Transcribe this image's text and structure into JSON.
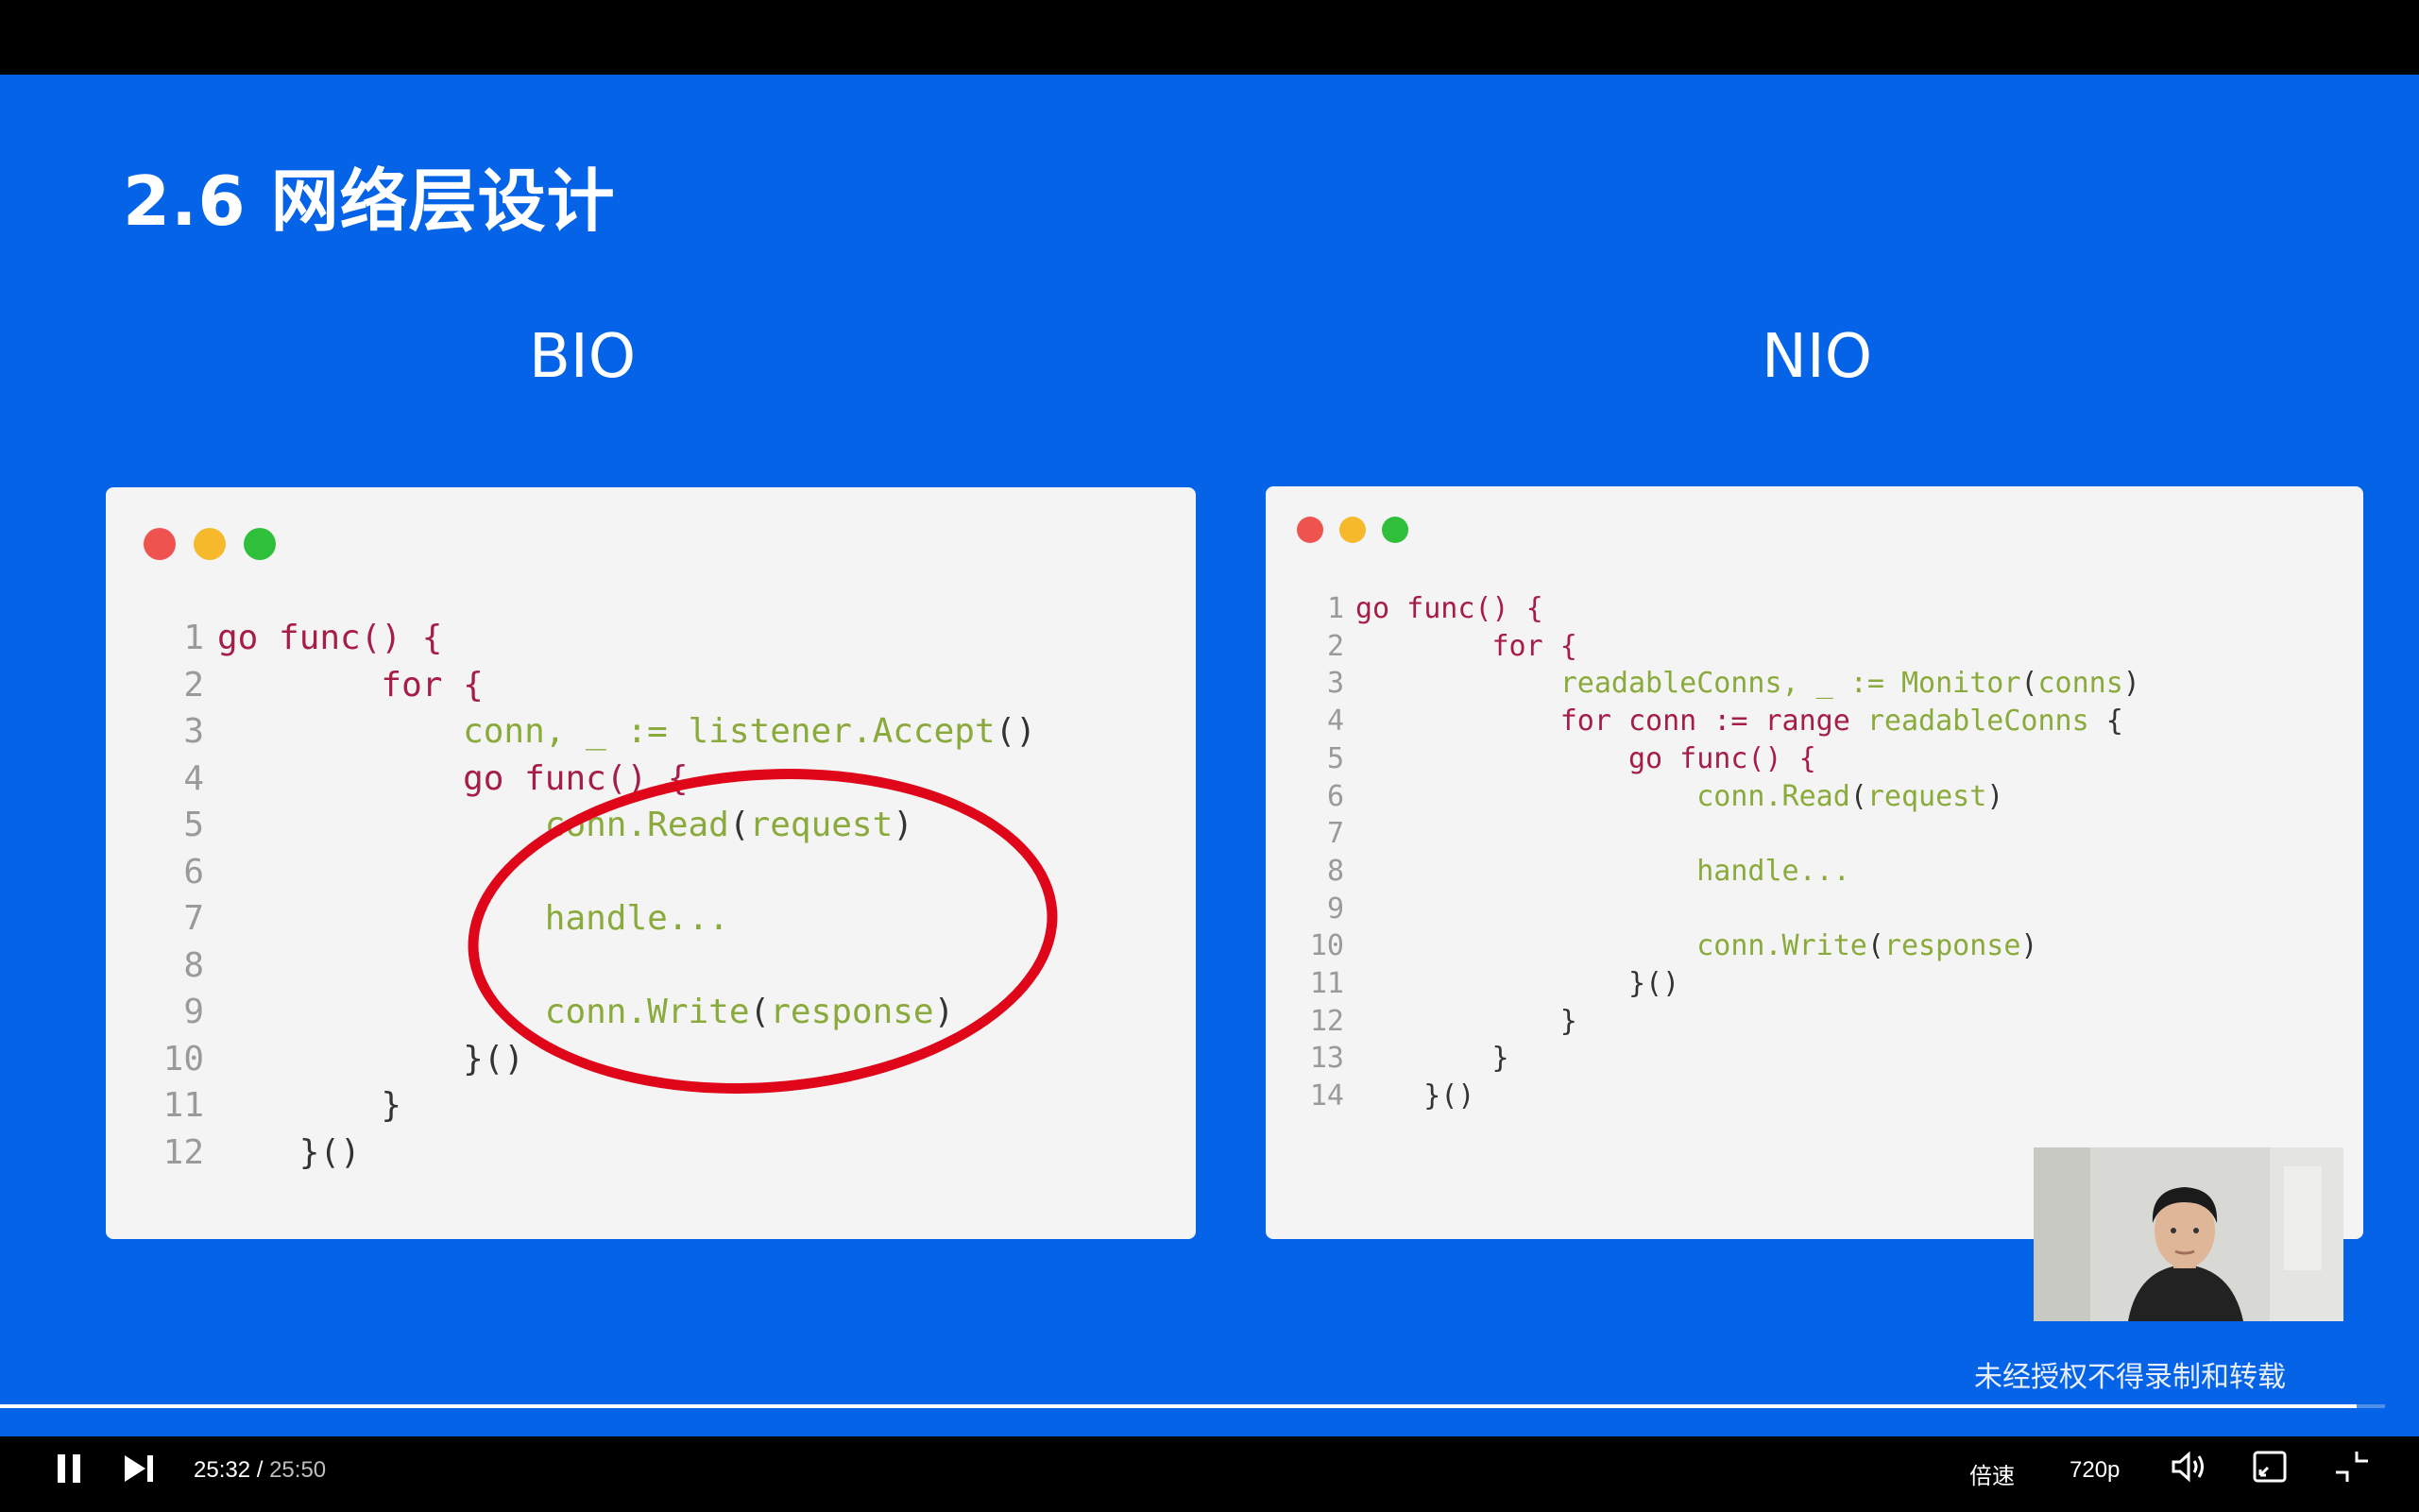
{
  "slide": {
    "title": "2.6 网络层设计",
    "left_heading": "BIO",
    "right_heading": "NIO",
    "window_dots": [
      "#ef5350",
      "#f6b92b",
      "#2fbf3a"
    ],
    "bio_code": [
      {
        "n": "1",
        "segments": [
          {
            "t": "go func() {",
            "c": "kw"
          }
        ]
      },
      {
        "n": "2",
        "segments": [
          {
            "t": "        for {",
            "c": "kw"
          }
        ]
      },
      {
        "n": "3",
        "segments": [
          {
            "t": "            conn, _ := listener.Accept",
            "c": "gr"
          },
          {
            "t": "()",
            "c": "pl"
          }
        ]
      },
      {
        "n": "4",
        "segments": [
          {
            "t": "            go func() {",
            "c": "kw"
          }
        ]
      },
      {
        "n": "5",
        "segments": [
          {
            "t": "                conn.Read",
            "c": "gr"
          },
          {
            "t": "(",
            "c": "pl"
          },
          {
            "t": "request",
            "c": "gr"
          },
          {
            "t": ")",
            "c": "pl"
          }
        ]
      },
      {
        "n": "6",
        "segments": []
      },
      {
        "n": "7",
        "segments": [
          {
            "t": "                handle...",
            "c": "gr"
          }
        ]
      },
      {
        "n": "8",
        "segments": []
      },
      {
        "n": "9",
        "segments": [
          {
            "t": "                conn.Write",
            "c": "gr"
          },
          {
            "t": "(",
            "c": "pl"
          },
          {
            "t": "response",
            "c": "gr"
          },
          {
            "t": ")",
            "c": "pl"
          }
        ]
      },
      {
        "n": "10",
        "segments": [
          {
            "t": "            }()",
            "c": "pl"
          }
        ]
      },
      {
        "n": "11",
        "segments": [
          {
            "t": "        }",
            "c": "pl"
          }
        ]
      },
      {
        "n": "12",
        "segments": [
          {
            "t": "    }()",
            "c": "pl"
          }
        ]
      }
    ],
    "nio_code": [
      {
        "n": "1",
        "segments": [
          {
            "t": "go func() {",
            "c": "kw"
          }
        ]
      },
      {
        "n": "2",
        "segments": [
          {
            "t": "        for {",
            "c": "kw"
          }
        ]
      },
      {
        "n": "3",
        "segments": [
          {
            "t": "            readableConns, _ := Monitor",
            "c": "gr"
          },
          {
            "t": "(",
            "c": "pl"
          },
          {
            "t": "conns",
            "c": "gr"
          },
          {
            "t": ")",
            "c": "pl"
          }
        ]
      },
      {
        "n": "4",
        "segments": [
          {
            "t": "            for conn := range ",
            "c": "kw"
          },
          {
            "t": "readableConns",
            "c": "gr"
          },
          {
            "t": " {",
            "c": "pl"
          }
        ]
      },
      {
        "n": "5",
        "segments": [
          {
            "t": "                go func() {",
            "c": "kw"
          }
        ]
      },
      {
        "n": "6",
        "segments": [
          {
            "t": "                    conn.Read",
            "c": "gr"
          },
          {
            "t": "(",
            "c": "pl"
          },
          {
            "t": "request",
            "c": "gr"
          },
          {
            "t": ")",
            "c": "pl"
          }
        ]
      },
      {
        "n": "7",
        "segments": []
      },
      {
        "n": "8",
        "segments": [
          {
            "t": "                    handle...",
            "c": "gr"
          }
        ]
      },
      {
        "n": "9",
        "segments": []
      },
      {
        "n": "10",
        "segments": [
          {
            "t": "                    conn.Write",
            "c": "gr"
          },
          {
            "t": "(",
            "c": "pl"
          },
          {
            "t": "response",
            "c": "gr"
          },
          {
            "t": ")",
            "c": "pl"
          }
        ]
      },
      {
        "n": "11",
        "segments": [
          {
            "t": "                }()",
            "c": "pl"
          }
        ]
      },
      {
        "n": "12",
        "segments": [
          {
            "t": "            }",
            "c": "pl"
          }
        ]
      },
      {
        "n": "13",
        "segments": [
          {
            "t": "        }",
            "c": "pl"
          }
        ]
      },
      {
        "n": "14",
        "segments": [
          {
            "t": "    }()",
            "c": "pl"
          }
        ]
      }
    ],
    "watermark": "未经授权不得录制和转载"
  },
  "player": {
    "current_time": "25:32",
    "separator": " / ",
    "duration": "25:50",
    "progress": 0.988,
    "speed_label": "倍速",
    "quality_label": "720p",
    "icons": [
      "pause-icon",
      "next-icon",
      "volume-icon",
      "picture-in-picture-icon",
      "exit-fullscreen-icon"
    ]
  },
  "colors": {
    "slide_background": "#0463e6",
    "code_keyword": "#a61d45",
    "code_identifier": "#8aaa3c",
    "annotation_circle": "#e0061a"
  }
}
